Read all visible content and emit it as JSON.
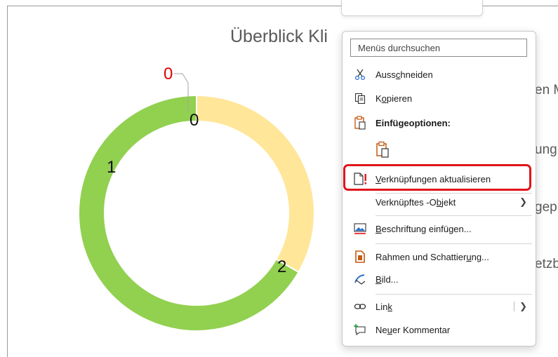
{
  "chart": {
    "title": "Überblick Kli",
    "legend_fragments": [
      "en M",
      "ung",
      "gep",
      "etzb"
    ],
    "slices": [
      {
        "label": "0",
        "value": 0,
        "color": "#e30000"
      },
      {
        "label": "1",
        "value": 1,
        "color": "#ffe699"
      },
      {
        "label": "2",
        "value": 2,
        "color": "#92d050"
      }
    ],
    "zero_label_inner": "0",
    "zero_label_outer": "0"
  },
  "context_menu": {
    "search_placeholder": "Menüs durchsuchen",
    "items": [
      {
        "label": "Ausschneiden",
        "icon": "scissors-icon"
      },
      {
        "label": "Kopieren",
        "icon": "copy-icon"
      },
      {
        "label": "Einfügeoptionen:",
        "icon": "paste-options-icon"
      },
      {
        "label": "",
        "icon": "paste-icon"
      },
      {
        "label": "Verknüpfungen aktualisieren",
        "icon": "update-links-icon"
      },
      {
        "label": "Verknüpftes -Objekt",
        "icon": ""
      },
      {
        "label": "Beschriftung einfügen...",
        "icon": "insert-caption-icon"
      },
      {
        "label": "Rahmen und Schattierung...",
        "icon": "borders-shading-icon"
      },
      {
        "label": "Bild...",
        "icon": "picture-format-icon"
      },
      {
        "label": "Link",
        "icon": "link-icon"
      },
      {
        "label": "Neuer Kommentar",
        "icon": "new-comment-icon"
      }
    ]
  },
  "colors": {
    "highlight": "#e1141b",
    "accent_orange": "#c55a11"
  }
}
